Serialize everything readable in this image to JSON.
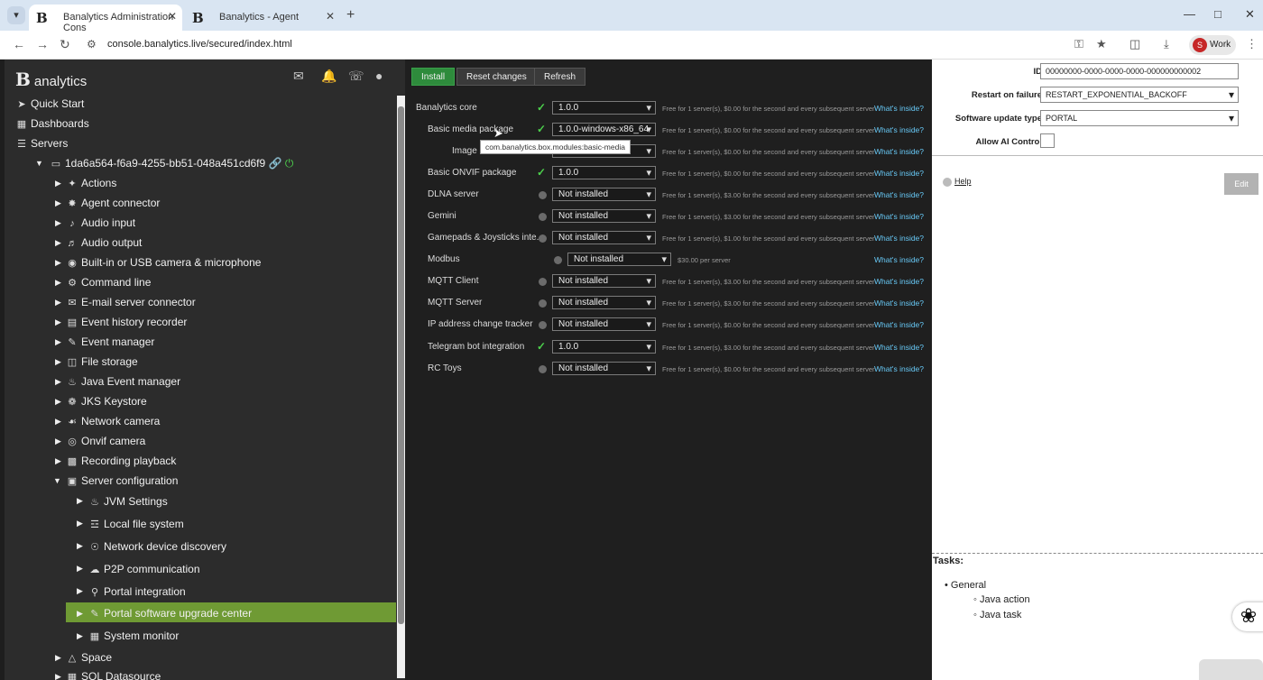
{
  "browser": {
    "tabs": [
      {
        "title": "Banalytics Administration Cons",
        "active": true
      },
      {
        "title": "Banalytics - Agent",
        "active": false
      }
    ],
    "url": "console.banalytics.live/secured/index.html",
    "profile_label": "Work",
    "profile_initial": "S"
  },
  "sidebar": {
    "brand": "analytics",
    "brand_mark": "B",
    "items": {
      "quick_start": "Quick Start",
      "dashboards": "Dashboards",
      "servers": "Servers",
      "server_id": "1da6a564-f6a9-4255-bb51-048a451cd6f9",
      "actions": "Actions",
      "agent_connector": "Agent connector",
      "audio_input": "Audio input",
      "audio_output": "Audio output",
      "camera_mic": "Built-in or USB camera & microphone",
      "command_line": "Command line",
      "email_connector": "E-mail server connector",
      "event_history": "Event history recorder",
      "event_manager": "Event manager",
      "file_storage": "File storage",
      "java_event_manager": "Java Event manager",
      "jks_keystore": "JKS Keystore",
      "network_camera": "Network camera",
      "onvif_camera": "Onvif camera",
      "recording_playback": "Recording playback",
      "server_configuration": "Server configuration",
      "jvm_settings": "JVM Settings",
      "local_fs": "Local file system",
      "net_discovery": "Network device discovery",
      "p2p": "P2P communication",
      "portal_integration": "Portal integration",
      "portal_upgrade": "Portal software upgrade center",
      "system_monitor": "System monitor",
      "space": "Space",
      "sql_datasource": "SQL Datasource"
    }
  },
  "toolbar": {
    "install": "Install",
    "reset": "Reset changes",
    "refresh": "Refresh"
  },
  "modules": [
    {
      "name": "Banalytics core",
      "status": "installed",
      "version": "1.0.0",
      "price": "Free for 1 server(s), $0.00 for the second and every subsequent server",
      "link": "What's inside?"
    },
    {
      "name": "Basic media package",
      "status": "installed",
      "version": "1.0.0-windows-x86_64",
      "price": "Free for 1 server(s), $0.00 for the second and every subsequent server",
      "link": "What's inside?"
    },
    {
      "name": "Image c",
      "status": "none",
      "version": "",
      "price": "Free for 1 server(s), $0.00 for the second and every subsequent server",
      "link": "What's inside?"
    },
    {
      "name": "Basic ONVIF package",
      "status": "installed",
      "version": "1.0.0",
      "price": "Free for 1 server(s), $0.00 for the second and every subsequent server",
      "link": "What's inside?"
    },
    {
      "name": "DLNA server",
      "status": "off",
      "version": "Not installed",
      "price": "Free for 1 server(s), $3.00 for the second and every subsequent server",
      "link": "What's inside?"
    },
    {
      "name": "Gemini",
      "status": "off",
      "version": "Not installed",
      "price": "Free for 1 server(s), $3.00 for the second and every subsequent server",
      "link": "What's inside?"
    },
    {
      "name": "Gamepads & Joysticks inte...",
      "status": "off",
      "version": "Not installed",
      "price": "Free for 1 server(s), $1.00 for the second and every subsequent server",
      "link": "What's inside?"
    },
    {
      "name": "Modbus",
      "status": "off",
      "version": "Not installed",
      "price": "$30.00 per server",
      "link": "What's inside?"
    },
    {
      "name": "MQTT Client",
      "status": "off",
      "version": "Not installed",
      "price": "Free for 1 server(s), $3.00 for the second and every subsequent server",
      "link": "What's inside?"
    },
    {
      "name": "MQTT Server",
      "status": "off",
      "version": "Not installed",
      "price": "Free for 1 server(s), $3.00 for the second and every subsequent server",
      "link": "What's inside?"
    },
    {
      "name": "IP address change tracker",
      "status": "off",
      "version": "Not installed",
      "price": "Free for 1 server(s), $0.00 for the second and every subsequent server",
      "link": "What's inside?"
    },
    {
      "name": "Telegram bot integration",
      "status": "installed",
      "version": "1.0.0",
      "price": "Free for 1 server(s), $3.00 for the second and every subsequent server",
      "link": "What's inside?"
    },
    {
      "name": "RC Toys",
      "status": "off",
      "version": "Not installed",
      "price": "Free for 1 server(s), $0.00 for the second and every subsequent server",
      "link": "What's inside?"
    }
  ],
  "tooltip": "com.banalytics.box.modules:basic-media",
  "properties": {
    "id_label": "ID",
    "id_value": "00000000-0000-0000-0000-000000000002",
    "restart_label": "Restart on failure",
    "restart_value": "RESTART_EXPONENTIAL_BACKOFF",
    "update_label": "Software update type",
    "update_value": "PORTAL",
    "ai_label": "Allow AI Control",
    "help": "Help",
    "edit": "Edit"
  },
  "tasks": {
    "title": "Tasks:",
    "general": "General",
    "java_action": "Java action",
    "java_task": "Java task"
  },
  "colors": {
    "accent_green": "#6f9a34",
    "install_green": "#2e8b3c",
    "link_blue": "#67c8f5",
    "check_green": "#4cd04c"
  }
}
